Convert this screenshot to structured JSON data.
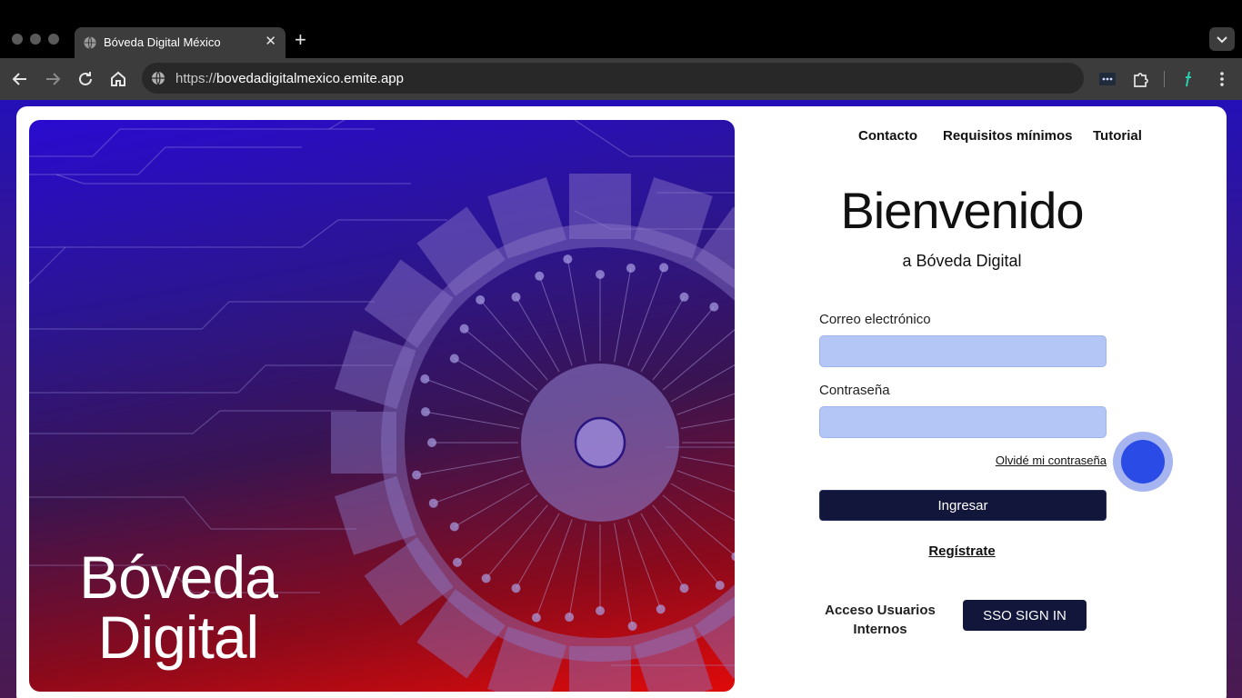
{
  "browser": {
    "tab_title": "Bóveda Digital México",
    "url_scheme": "https://",
    "url_host": "bovedadigitalmexico.emite.app"
  },
  "hero": {
    "title_line1": "Bóveda",
    "title_line2": "Digital"
  },
  "nav": {
    "contact": "Contacto",
    "requirements": "Requisitos mínimos",
    "tutorial": "Tutorial"
  },
  "login": {
    "heading": "Bienvenido",
    "subheading": "a Bóveda Digital",
    "email_label": "Correo electrónico",
    "email_value": "",
    "password_label": "Contraseña",
    "password_value": "",
    "forgot_link": "Olvidé mi contraseña",
    "submit_label": "Ingresar",
    "register_link": "Regístrate",
    "internal_label_line1": "Acceso Usuarios",
    "internal_label_line2": "Internos",
    "sso_label": "SSO SIGN IN"
  },
  "colors": {
    "accent_dark": "#11163a",
    "input_fill": "#b4c6f5",
    "bubble": "#2a4be6"
  }
}
